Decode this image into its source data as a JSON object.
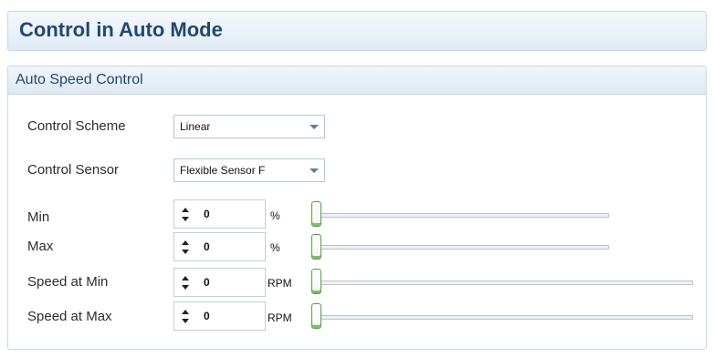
{
  "top_fragment": "",
  "page": {
    "title": "Control in Auto Mode"
  },
  "group": {
    "title": "Auto Speed Control",
    "control_scheme": {
      "label": "Control Scheme",
      "value": "Linear"
    },
    "control_sensor": {
      "label": "Control Sensor",
      "value": "Flexible Sensor F"
    },
    "rows": [
      {
        "label": "Min",
        "value": "0",
        "unit": "%",
        "slider_fraction": 0
      },
      {
        "label": "Max",
        "value": "0",
        "unit": "%",
        "slider_fraction": 0
      },
      {
        "label": "Speed at Min",
        "value": "0",
        "unit": "RPM",
        "slider_fraction": 0
      },
      {
        "label": "Speed at Max",
        "value": "0",
        "unit": "RPM",
        "slider_fraction": 0
      }
    ]
  },
  "colors": {
    "title": "#23486e",
    "accent_green": "#7cc062",
    "border": "#c9d7e6"
  }
}
